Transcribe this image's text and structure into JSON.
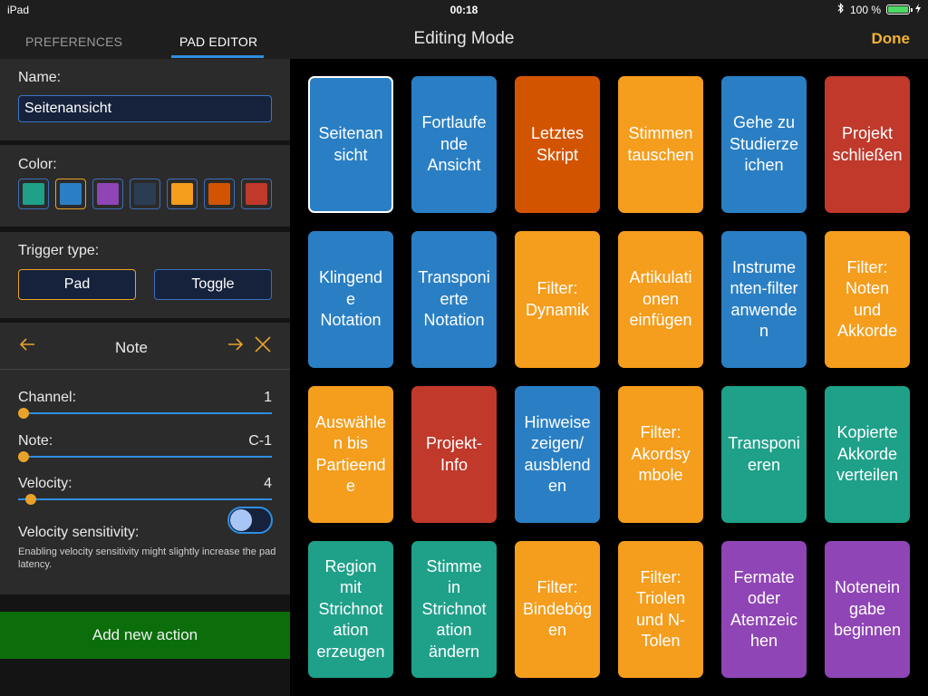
{
  "status_bar": {
    "device": "iPad",
    "time": "00:18",
    "battery": "100 %",
    "battery_level": 1.0
  },
  "nav": {
    "tabs": [
      {
        "label": "PREFERENCES"
      },
      {
        "label": "PAD EDITOR"
      }
    ],
    "title": "Editing Mode",
    "done_label": "Done"
  },
  "editor": {
    "name_label": "Name:",
    "name_value": "Seitenansicht",
    "color_label": "Color:",
    "colors": [
      "#1fa089",
      "#2a7fc4",
      "#8f45b5",
      "#2b3d52",
      "#f59d1c",
      "#d35400",
      "#c0392b"
    ],
    "selected_color_index": 1,
    "trigger_label": "Trigger type:",
    "trigger_options": [
      "Pad",
      "Toggle"
    ],
    "selected_trigger_index": 0,
    "action_title": "Note",
    "channel_label": "Channel:",
    "channel_value": "1",
    "channel_level": 0.0,
    "note_label": "Note:",
    "note_value": "C-1",
    "note_level": 0.0,
    "velocity_label": "Velocity:",
    "velocity_value": "4",
    "velocity_level": 0.03,
    "sensitivity_label": "Velocity sensitivity:",
    "sensitivity_on": false,
    "sensitivity_hint": "Enabling velocity sensitivity might slightly increase the pad latency.",
    "add_action_label": "Add new action"
  },
  "pads": [
    {
      "label": "Seitenansicht",
      "lines": [
        "Seitenan",
        "sicht"
      ],
      "color": "#2a7fc4",
      "selected": true
    },
    {
      "label": "Fortlaufende Ansicht",
      "lines": [
        "Fortlaufe",
        "nde",
        "Ansicht"
      ],
      "color": "#2a7fc4"
    },
    {
      "label": "Letztes Skript",
      "lines": [
        "Letztes",
        "Skript"
      ],
      "color": "#d35400"
    },
    {
      "label": "Stimmen tauschen",
      "lines": [
        "Stimmen",
        "tauschen"
      ],
      "color": "#f59d1c"
    },
    {
      "label": "Gehe zu Studierzeichen",
      "lines": [
        "Gehe zu",
        "Studierze",
        "ichen"
      ],
      "color": "#2a7fc4"
    },
    {
      "label": "Projekt schließen",
      "lines": [
        "Projekt",
        "schließen"
      ],
      "color": "#c0392b"
    },
    {
      "label": "Klingende Notation",
      "lines": [
        "Klingend",
        "e",
        "Notation"
      ],
      "color": "#2a7fc4"
    },
    {
      "label": "Transponierte Notation",
      "lines": [
        "Transponi",
        "erte",
        "Notation"
      ],
      "color": "#2a7fc4"
    },
    {
      "label": "Filter: Dynamik",
      "lines": [
        "Filter:",
        "Dynamik"
      ],
      "color": "#f59d1c"
    },
    {
      "label": "Artikulationen einfügen",
      "lines": [
        "Artikulati",
        "onen",
        "einfügen"
      ],
      "color": "#f59d1c"
    },
    {
      "label": "Instrumenten-filter anwenden",
      "lines": [
        "Instrume",
        "nten-filter",
        "anwende",
        "n"
      ],
      "color": "#2a7fc4"
    },
    {
      "label": "Filter: Noten und Akkorde",
      "lines": [
        "Filter:",
        "Noten",
        "und",
        "Akkorde"
      ],
      "color": "#f59d1c"
    },
    {
      "label": "Auswählen bis Partieende",
      "lines": [
        "Auswähle",
        "n bis",
        "Partieend",
        "e"
      ],
      "color": "#f59d1c"
    },
    {
      "label": "Projekt-Info",
      "lines": [
        "Projekt-",
        "Info"
      ],
      "color": "#c0392b"
    },
    {
      "label": "Hinweise zeigen/ ausblenden",
      "lines": [
        "Hinweise",
        "zeigen/",
        "ausblend",
        "en"
      ],
      "color": "#2a7fc4"
    },
    {
      "label": "Filter: Akordsymbole",
      "lines": [
        "Filter:",
        "Akordsy",
        "mbole"
      ],
      "color": "#f59d1c"
    },
    {
      "label": "Transponieren",
      "lines": [
        "Transponi",
        "eren"
      ],
      "color": "#1fa089"
    },
    {
      "label": "Kopierte Akkorde verteilen",
      "lines": [
        "Kopierte",
        "Akkorde",
        "verteilen"
      ],
      "color": "#1fa089"
    },
    {
      "label": "Region mit Strichnotation erzeugen",
      "lines": [
        "Region",
        "mit",
        "Strichnot",
        "ation",
        "erzeugen"
      ],
      "color": "#1fa089"
    },
    {
      "label": "Stimme in Strichnotation ändern",
      "lines": [
        "Stimme",
        "in",
        "Strichnot",
        "ation",
        "ändern"
      ],
      "color": "#1fa089"
    },
    {
      "label": "Filter: Bindebögen",
      "lines": [
        "Filter:",
        "Bindebög",
        "en"
      ],
      "color": "#f59d1c"
    },
    {
      "label": "Filter: Triolen und N-Tolen",
      "lines": [
        "Filter:",
        "Triolen",
        "und N-",
        "Tolen"
      ],
      "color": "#f59d1c"
    },
    {
      "label": "Fermate oder Atemzeichen",
      "lines": [
        "Fermate",
        "oder",
        "Atemzeic",
        "hen"
      ],
      "color": "#8f45b5"
    },
    {
      "label": "Noteneingabe beginnen",
      "lines": [
        "Notenein",
        "gabe",
        "beginnen"
      ],
      "color": "#8f45b5"
    }
  ]
}
